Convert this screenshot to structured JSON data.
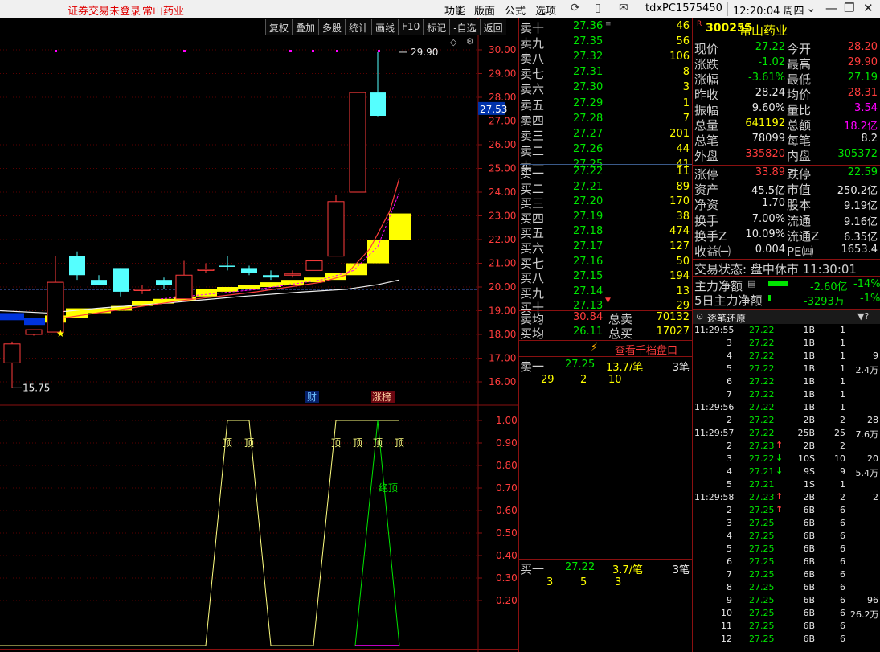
{
  "titlebar": {
    "login_status": "证券交易未登录",
    "stock_name": "常山药业",
    "menus": [
      "功能",
      "版面",
      "公式",
      "选项"
    ],
    "user": "tdxPC1575450",
    "clock": "12:20:04 周四"
  },
  "toolbar": {
    "items": [
      "复权",
      "叠加",
      "多股",
      "统计",
      "画线",
      "F10",
      "标记",
      "-自选",
      "返回"
    ]
  },
  "chart": {
    "price_ticks": [
      "30.00",
      "29.00",
      "28.00",
      "27.00",
      "26.00",
      "25.00",
      "24.00",
      "23.00",
      "22.00",
      "21.00",
      "20.00",
      "19.00",
      "18.00",
      "17.00",
      "16.00"
    ],
    "current_price_tag": "27.53",
    "high_label": "29.90",
    "low_label": "15.75",
    "markers": {
      "cai": "财",
      "zhangbang": "涨榜"
    },
    "colors": {
      "up": "#ff3c3c",
      "down": "#55ffff",
      "yellow": "#ffff00",
      "blue": "#0033dd",
      "grid": "#5a0000"
    },
    "candles": [
      {
        "o": 16.8,
        "c": 17.6,
        "h": 17.7,
        "l": 15.75,
        "type": "up"
      },
      {
        "o": 18.0,
        "c": 18.2,
        "h": 18.2,
        "l": 17.95,
        "type": "up"
      },
      {
        "o": 18.1,
        "c": 20.2,
        "h": 21.3,
        "l": 18.1,
        "type": "up"
      },
      {
        "o": 21.3,
        "c": 20.5,
        "h": 21.5,
        "l": 20.3,
        "type": "down"
      },
      {
        "o": 20.1,
        "c": 20.3,
        "h": 20.5,
        "l": 20.1,
        "type": "down"
      },
      {
        "o": 20.8,
        "c": 19.8,
        "h": 20.8,
        "l": 19.6,
        "type": "down"
      },
      {
        "o": 19.9,
        "c": 19.85,
        "h": 20.1,
        "l": 19.7,
        "type": "up"
      },
      {
        "o": 20.3,
        "c": 20.1,
        "h": 20.4,
        "l": 19.9,
        "type": "down"
      },
      {
        "o": 19.5,
        "c": 20.5,
        "h": 21.1,
        "l": 19.5,
        "type": "up"
      },
      {
        "o": 20.7,
        "c": 20.75,
        "h": 21.0,
        "l": 20.6,
        "type": "up"
      },
      {
        "o": 20.9,
        "c": 20.9,
        "h": 21.3,
        "l": 20.7,
        "type": "down"
      },
      {
        "o": 20.8,
        "c": 20.6,
        "h": 20.9,
        "l": 20.5,
        "type": "down"
      },
      {
        "o": 20.5,
        "c": 20.4,
        "h": 20.7,
        "l": 20.3,
        "type": "down"
      },
      {
        "o": 20.55,
        "c": 20.5,
        "h": 20.7,
        "l": 20.4,
        "type": "up"
      },
      {
        "o": 20.7,
        "c": 21.1,
        "h": 21.1,
        "l": 20.7,
        "type": "up"
      },
      {
        "o": 21.3,
        "c": 23.6,
        "h": 23.9,
        "l": 21.3,
        "type": "up"
      },
      {
        "o": 24.0,
        "c": 28.2,
        "h": 28.2,
        "l": 24.0,
        "type": "up"
      },
      {
        "o": 28.2,
        "c": 27.22,
        "h": 29.9,
        "l": 27.2,
        "type": "down"
      }
    ],
    "indicator_ticks": [
      "1.00",
      "0.90",
      "0.80",
      "0.70",
      "0.60",
      "0.50",
      "0.40",
      "0.30",
      "0.20"
    ],
    "indicator_labels": {
      "top": "顶",
      "peak": "绝顶"
    }
  },
  "orderbook": {
    "asks": [
      {
        "label": "卖十",
        "price": "27.36",
        "vol": "46"
      },
      {
        "label": "卖九",
        "price": "27.35",
        "vol": "56"
      },
      {
        "label": "卖八",
        "price": "27.32",
        "vol": "106"
      },
      {
        "label": "卖七",
        "price": "27.31",
        "vol": "8"
      },
      {
        "label": "卖六",
        "price": "27.30",
        "vol": "3"
      },
      {
        "label": "卖五",
        "price": "27.29",
        "vol": "1"
      },
      {
        "label": "卖四",
        "price": "27.28",
        "vol": "7"
      },
      {
        "label": "卖三",
        "price": "27.27",
        "vol": "201"
      },
      {
        "label": "卖二",
        "price": "27.26",
        "vol": "44"
      },
      {
        "label": "卖一",
        "price": "27.25",
        "vol": "41"
      }
    ],
    "bids": [
      {
        "label": "买一",
        "price": "27.22",
        "vol": "11"
      },
      {
        "label": "买二",
        "price": "27.21",
        "vol": "89"
      },
      {
        "label": "买三",
        "price": "27.20",
        "vol": "170"
      },
      {
        "label": "买四",
        "price": "27.19",
        "vol": "38"
      },
      {
        "label": "买五",
        "price": "27.18",
        "vol": "474"
      },
      {
        "label": "买六",
        "price": "27.17",
        "vol": "127"
      },
      {
        "label": "买七",
        "price": "27.16",
        "vol": "50"
      },
      {
        "label": "买八",
        "price": "27.15",
        "vol": "194"
      },
      {
        "label": "买九",
        "price": "27.14",
        "vol": "13"
      },
      {
        "label": "买十",
        "price": "27.13",
        "vol": "29"
      }
    ],
    "avg": {
      "sell_avg_label": "卖均",
      "sell_avg": "30.84",
      "sell_total_label": "总卖",
      "sell_total": "70132",
      "buy_avg_label": "买均",
      "buy_avg": "26.11",
      "buy_total_label": "总买",
      "buy_total": "17027"
    },
    "qianDang": "查看千档盘口",
    "sell1": {
      "label": "卖一",
      "price": "27.25",
      "avg": "13.7/笔",
      "count": "3笔",
      "q1": "29",
      "q2": "2",
      "q3": "10"
    },
    "buy1": {
      "label": "买一",
      "price": "27.22",
      "avg": "3.7/笔",
      "count": "3笔",
      "q1": "3",
      "q2": "5",
      "q3": "3"
    }
  },
  "quote": {
    "badge": "R",
    "code": "300255",
    "name": "常山药业",
    "rows": [
      [
        {
          "l": "现价",
          "v": "27.22",
          "c": "green"
        },
        {
          "l": "今开",
          "v": "28.20",
          "c": "red"
        }
      ],
      [
        {
          "l": "涨跌",
          "v": "-1.02",
          "c": "green"
        },
        {
          "l": "最高",
          "v": "29.90",
          "c": "red"
        }
      ],
      [
        {
          "l": "涨幅",
          "v": "-3.61%",
          "c": "green"
        },
        {
          "l": "最低",
          "v": "27.19",
          "c": "green"
        }
      ],
      [
        {
          "l": "昨收",
          "v": "28.24",
          "c": "white"
        },
        {
          "l": "均价",
          "v": "28.31",
          "c": "red"
        }
      ],
      [
        {
          "l": "振幅",
          "v": "9.60%",
          "c": "white"
        },
        {
          "l": "量比",
          "v": "3.54",
          "c": "mag"
        }
      ],
      [
        {
          "l": "总量",
          "v": "641192",
          "c": "yellow"
        },
        {
          "l": "总额",
          "v": "18.2亿",
          "c": "mag"
        }
      ],
      [
        {
          "l": "总笔",
          "v": "78099",
          "c": "white"
        },
        {
          "l": "每笔",
          "v": "8.2",
          "c": "white"
        }
      ],
      [
        {
          "l": "外盘",
          "v": "335820",
          "c": "red"
        },
        {
          "l": "内盘",
          "v": "305372",
          "c": "green"
        }
      ]
    ],
    "rows2": [
      [
        {
          "l": "涨停",
          "v": "33.89",
          "c": "red"
        },
        {
          "l": "跌停",
          "v": "22.59",
          "c": "green"
        }
      ],
      [
        {
          "l": "资产",
          "v": "45.5亿",
          "c": "white"
        },
        {
          "l": "市值",
          "v": "250.2亿",
          "c": "white"
        }
      ],
      [
        {
          "l": "净资",
          "v": "1.70",
          "c": "white"
        },
        {
          "l": "股本",
          "v": "9.19亿",
          "c": "white"
        }
      ],
      [
        {
          "l": "换手",
          "v": "7.00%",
          "c": "white"
        },
        {
          "l": "流通",
          "v": "9.16亿",
          "c": "white"
        }
      ],
      [
        {
          "l": "换手Z",
          "v": "10.09%",
          "c": "white"
        },
        {
          "l": "流通Z",
          "v": "6.35亿",
          "c": "white"
        }
      ],
      [
        {
          "l": "收益㈠",
          "v": "0.004",
          "c": "white"
        },
        {
          "l": "PE㈣",
          "v": "1653.4",
          "c": "white"
        }
      ]
    ],
    "trade_status": "交易状态: 盘中休市 11:30:01",
    "main_flow_label": "主力净额",
    "main_flow": "-2.60亿",
    "main_flow_pct": "-14%",
    "main5_label": "5日主力净额",
    "main5": "-3293万",
    "main5_pct": "-1%"
  },
  "ticks": {
    "title": "逐笔还原",
    "rows": [
      {
        "t": "11:29:55",
        "p": "27.22",
        "v": "1B",
        "n": "1",
        "c": "green",
        "a": "",
        "ex": ""
      },
      {
        "t": "3",
        "p": "27.22",
        "v": "1B",
        "n": "1",
        "c": "green",
        "a": "",
        "ex": ""
      },
      {
        "t": "4",
        "p": "27.22",
        "v": "1B",
        "n": "1",
        "c": "green",
        "a": "",
        "ex": "9"
      },
      {
        "t": "5",
        "p": "27.22",
        "v": "1B",
        "n": "1",
        "c": "green",
        "a": "",
        "ex": "2.4万"
      },
      {
        "t": "6",
        "p": "27.22",
        "v": "1B",
        "n": "1",
        "c": "green",
        "a": "",
        "ex": ""
      },
      {
        "t": "7",
        "p": "27.22",
        "v": "1B",
        "n": "1",
        "c": "green",
        "a": "",
        "ex": ""
      },
      {
        "t": "11:29:56",
        "p": "27.22",
        "v": "1B",
        "n": "1",
        "c": "green",
        "a": "",
        "ex": ""
      },
      {
        "t": "2",
        "p": "27.22",
        "v": "2B",
        "n": "2",
        "c": "green",
        "a": "",
        "ex": "28"
      },
      {
        "t": "11:29:57",
        "p": "27.22",
        "v": "25B",
        "n": "25",
        "c": "green",
        "a": "",
        "ex": "7.6万"
      },
      {
        "t": "2",
        "p": "27.23",
        "v": "2B",
        "n": "2",
        "c": "green",
        "a": "up",
        "ex": ""
      },
      {
        "t": "3",
        "p": "27.22",
        "v": "10S",
        "n": "10",
        "c": "green",
        "a": "down",
        "ex": "20"
      },
      {
        "t": "4",
        "p": "27.21",
        "v": "9S",
        "n": "9",
        "c": "green",
        "a": "down",
        "ex": "5.4万"
      },
      {
        "t": "5",
        "p": "27.21",
        "v": "1S",
        "n": "1",
        "c": "green",
        "a": "",
        "ex": ""
      },
      {
        "t": "11:29:58",
        "p": "27.23",
        "v": "2B",
        "n": "2",
        "c": "green",
        "a": "up",
        "ex": "2"
      },
      {
        "t": "2",
        "p": "27.25",
        "v": "6B",
        "n": "6",
        "c": "green",
        "a": "up",
        "ex": ""
      },
      {
        "t": "3",
        "p": "27.25",
        "v": "6B",
        "n": "6",
        "c": "green",
        "a": "",
        "ex": ""
      },
      {
        "t": "4",
        "p": "27.25",
        "v": "6B",
        "n": "6",
        "c": "green",
        "a": "",
        "ex": ""
      },
      {
        "t": "5",
        "p": "27.25",
        "v": "6B",
        "n": "6",
        "c": "green",
        "a": "",
        "ex": ""
      },
      {
        "t": "6",
        "p": "27.25",
        "v": "6B",
        "n": "6",
        "c": "green",
        "a": "",
        "ex": ""
      },
      {
        "t": "7",
        "p": "27.25",
        "v": "6B",
        "n": "6",
        "c": "green",
        "a": "",
        "ex": ""
      },
      {
        "t": "8",
        "p": "27.25",
        "v": "6B",
        "n": "6",
        "c": "green",
        "a": "",
        "ex": ""
      },
      {
        "t": "9",
        "p": "27.25",
        "v": "6B",
        "n": "6",
        "c": "green",
        "a": "",
        "ex": "96"
      },
      {
        "t": "10",
        "p": "27.25",
        "v": "6B",
        "n": "6",
        "c": "green",
        "a": "",
        "ex": "26.2万"
      },
      {
        "t": "11",
        "p": "27.25",
        "v": "6B",
        "n": "6",
        "c": "green",
        "a": "",
        "ex": ""
      },
      {
        "t": "12",
        "p": "27.25",
        "v": "6B",
        "n": "6",
        "c": "green",
        "a": "",
        "ex": ""
      }
    ]
  }
}
